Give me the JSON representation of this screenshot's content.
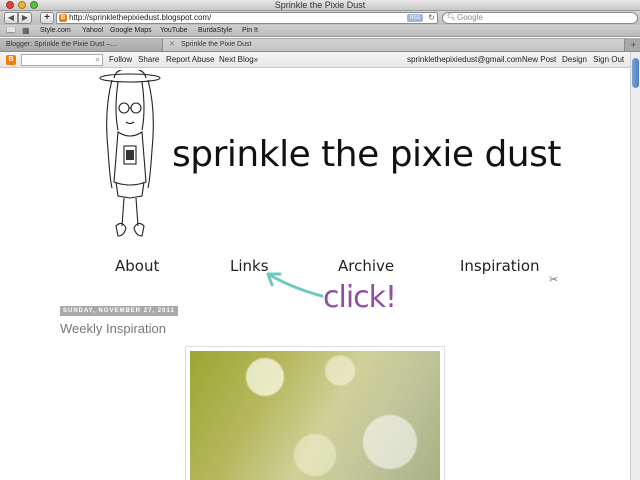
{
  "window": {
    "title": "Sprinkle the Pixie Dust"
  },
  "toolbar": {
    "back": "◀",
    "forward": "▶",
    "new_tab": "+",
    "url": "http://sprinklethepixiedust.blogspot.com/",
    "rss": "RSS",
    "reload": "↻",
    "search_placeholder": "Google",
    "search_icon": "magnifier-icon",
    "favicon": "B"
  },
  "bookmarks": {
    "items": [
      "Style.com",
      "Yahoo!",
      "Google Maps",
      "YouTube",
      "BurdaStyle",
      "Pin It"
    ],
    "reading_icon": "📖",
    "grid_icon": "▦"
  },
  "tabs": {
    "items": [
      "Blogger: Sprinkle the Pixie Dust –…",
      "Sprinkle the Pixie Dust"
    ],
    "close": "✕",
    "add": "+"
  },
  "navbar": {
    "logo": "B",
    "search_icon": "⌕",
    "links": [
      "Follow",
      "Share",
      "Report Abuse",
      "Next Blog»"
    ],
    "user_links": [
      "sprinklethepixiedust@gmail.com",
      "New Post",
      "Design",
      "Sign Out"
    ]
  },
  "blog": {
    "title": "sprinkle the pixie dust",
    "menu": [
      "About",
      "Links",
      "Archive",
      "Inspiration"
    ],
    "annotation": "click!",
    "sparkle": "✂"
  },
  "post": {
    "date": "SUNDAY, NOVEMBER 27, 2011",
    "title": "Weekly Inspiration"
  },
  "colors": {
    "annotation": "#8f4fa6",
    "arrow": "#6cc9c0",
    "blogger_orange": "#f57d00"
  }
}
